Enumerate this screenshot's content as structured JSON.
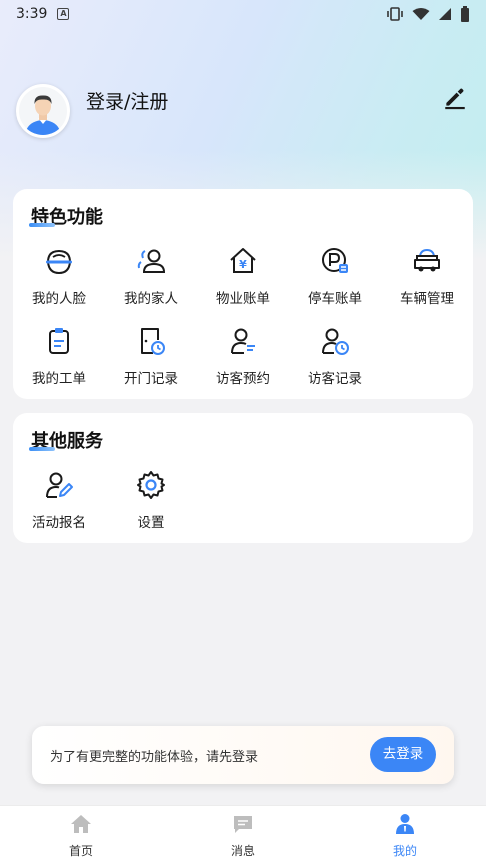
{
  "status_bar": {
    "time": "3:39",
    "notif_badge": "A"
  },
  "profile": {
    "login_text": "登录/注册"
  },
  "featured": {
    "title": "特色功能",
    "items": [
      {
        "label": "我的人脸",
        "icon": "face-icon"
      },
      {
        "label": "我的家人",
        "icon": "family-icon"
      },
      {
        "label": "物业账单",
        "icon": "property-bill-icon"
      },
      {
        "label": "停车账单",
        "icon": "parking-bill-icon"
      },
      {
        "label": "车辆管理",
        "icon": "car-icon"
      },
      {
        "label": "我的工单",
        "icon": "work-order-icon"
      },
      {
        "label": "开门记录",
        "icon": "door-record-icon"
      },
      {
        "label": "访客预约",
        "icon": "visitor-appointment-icon"
      },
      {
        "label": "访客记录",
        "icon": "visitor-record-icon"
      }
    ]
  },
  "other": {
    "title": "其他服务",
    "items": [
      {
        "label": "活动报名",
        "icon": "activity-signup-icon"
      },
      {
        "label": "设置",
        "icon": "settings-icon"
      }
    ]
  },
  "login_banner": {
    "message": "为了有更完整的功能体验，请先登录",
    "button": "去登录"
  },
  "tabs": [
    {
      "label": "首页",
      "icon": "home-icon"
    },
    {
      "label": "消息",
      "icon": "message-icon"
    },
    {
      "label": "我的",
      "icon": "profile-icon",
      "active": true
    }
  ],
  "colors": {
    "accent": "#3b86f6",
    "icon_dark": "#1a1a1a"
  }
}
